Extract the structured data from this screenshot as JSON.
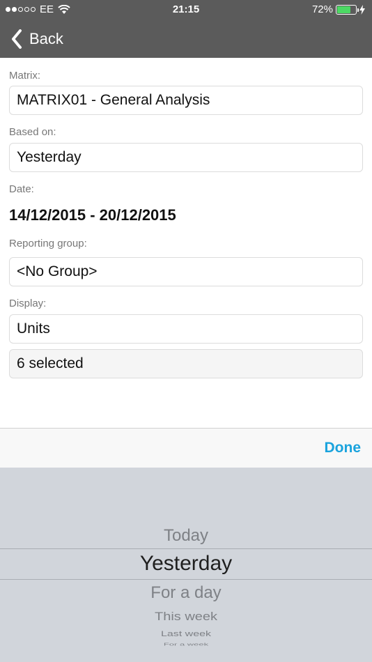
{
  "status_bar": {
    "carrier": "EE",
    "time": "21:15",
    "battery": "72%",
    "battery_level": 0.72,
    "battery_color": "#4cd964"
  },
  "nav": {
    "back_label": "Back"
  },
  "form": {
    "matrix_label": "Matrix:",
    "matrix_value": "MATRIX01 - General Analysis",
    "based_on_label": "Based on:",
    "based_on_value": "Yesterday",
    "date_label": "Date:",
    "date_value": "14/12/2015 - 20/12/2015",
    "reporting_group_label": "Reporting group:",
    "reporting_group_value": "<No Group>",
    "display_label": "Display:",
    "display_value": "Units",
    "selected_value": "6 selected"
  },
  "toolbar": {
    "done_label": "Done",
    "accent_color": "#1aa3dd"
  },
  "picker": {
    "options": [
      "Today",
      "Yesterday",
      "For a day",
      "This week",
      "Last week",
      "For a week"
    ],
    "selected": "Yesterday"
  }
}
